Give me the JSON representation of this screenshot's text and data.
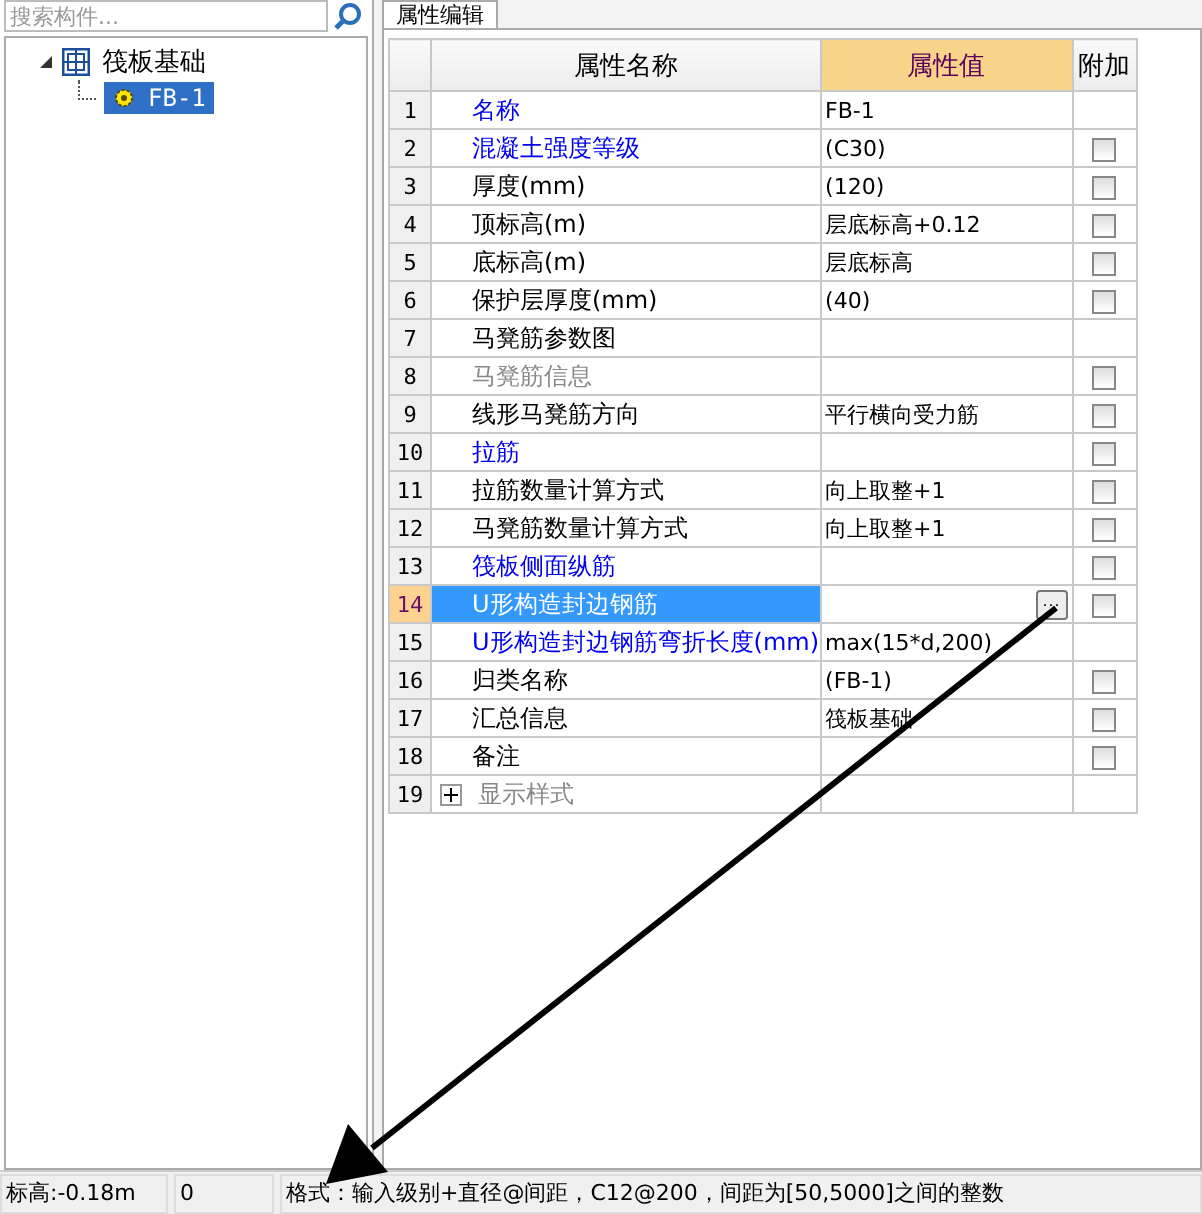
{
  "search": {
    "placeholder": "搜索构件..."
  },
  "tree": [
    {
      "label": "筏板基础",
      "expanded": true,
      "selected": false,
      "children": [
        {
          "label": "FB-1",
          "selected": true
        }
      ]
    }
  ],
  "tab": {
    "label": "属性编辑"
  },
  "table": {
    "columns": [
      "属性名称",
      "属性值",
      "附加"
    ],
    "rows": [
      {
        "num": "1",
        "name": "名称",
        "kind": "link",
        "value": "FB-1",
        "selected": false
      },
      {
        "num": "2",
        "name": "混凝土强度等级",
        "kind": "link",
        "value": "(C30)",
        "selected": false,
        "checked": false
      },
      {
        "num": "3",
        "name": "厚度(mm)",
        "kind": "normal",
        "value": "(120)",
        "selected": false,
        "checked": false
      },
      {
        "num": "4",
        "name": "顶标高(m)",
        "kind": "normal",
        "value": "层底标高+0.12",
        "selected": false,
        "checked": false
      },
      {
        "num": "5",
        "name": "底标高(m)",
        "kind": "normal",
        "value": "层底标高",
        "selected": false,
        "checked": false
      },
      {
        "num": "6",
        "name": "保护层厚度(mm)",
        "kind": "normal",
        "value": "(40)",
        "selected": false,
        "checked": false
      },
      {
        "num": "7",
        "name": "马凳筋参数图",
        "kind": "normal",
        "selected": false
      },
      {
        "num": "8",
        "name": "马凳筋信息",
        "kind": "disabled",
        "selected": false,
        "checked": false
      },
      {
        "num": "9",
        "name": "线形马凳筋方向",
        "kind": "normal",
        "value": "平行横向受力筋",
        "selected": false,
        "checked": false
      },
      {
        "num": "10",
        "name": "拉筋",
        "kind": "link",
        "selected": false,
        "checked": false
      },
      {
        "num": "11",
        "name": "拉筋数量计算方式",
        "kind": "normal",
        "value": "向上取整+1",
        "selected": false,
        "checked": false
      },
      {
        "num": "12",
        "name": "马凳筋数量计算方式",
        "kind": "normal",
        "value": "向上取整+1",
        "selected": false,
        "checked": false
      },
      {
        "num": "13",
        "name": "筏板侧面纵筋",
        "kind": "link",
        "selected": false,
        "checked": false
      },
      {
        "num": "14",
        "name": "U形构造封边钢筋",
        "kind": "link",
        "selected": true,
        "checked": false,
        "button": "···"
      },
      {
        "num": "15",
        "name": "U形构造封边钢筋弯折长度(mm)",
        "kind": "link",
        "value": "max(15*d,200)",
        "selected": false
      },
      {
        "num": "16",
        "name": "归类名称",
        "kind": "normal",
        "value": "(FB-1)",
        "selected": false,
        "checked": false
      },
      {
        "num": "17",
        "name": "汇总信息",
        "kind": "normal",
        "value": "筏板基础",
        "selected": false,
        "checked": false
      },
      {
        "num": "18",
        "name": "备注",
        "kind": "normal",
        "selected": false,
        "checked": false
      },
      {
        "num": "19",
        "name": "显示样式",
        "kind": "disabled",
        "expanded": false,
        "selected": false
      }
    ]
  },
  "status_bar": [
    "标高:-0.18m",
    "0",
    "格式：输入级别+直径@间距，C12@200，间距为[50,5000]之间的整数"
  ]
}
